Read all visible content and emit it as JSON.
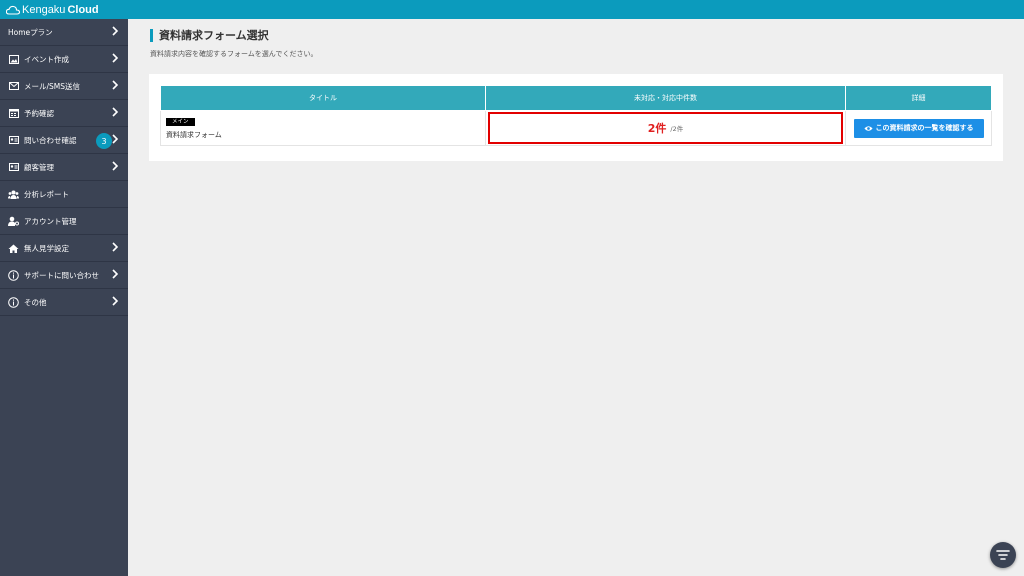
{
  "app": {
    "logo_light": "Kengaku",
    "logo_bold": "Cloud"
  },
  "sidebar": {
    "items": [
      {
        "label": "Homeプラン",
        "icon": "none",
        "has_chevron": true
      },
      {
        "label": "イベント作成",
        "icon": "image-icon",
        "has_chevron": true
      },
      {
        "label": "メール/SMS送信",
        "icon": "mail-icon",
        "has_chevron": true
      },
      {
        "label": "予約確認",
        "icon": "calendar-icon",
        "has_chevron": true
      },
      {
        "label": "問い合わせ確認",
        "icon": "id-card-icon",
        "has_chevron": true,
        "badge": "3"
      },
      {
        "label": "顧客管理",
        "icon": "id-card-icon",
        "has_chevron": true
      },
      {
        "label": "分析レポート",
        "icon": "users-icon",
        "has_chevron": false
      },
      {
        "label": "アカウント管理",
        "icon": "user-gear-icon",
        "has_chevron": false
      },
      {
        "label": "無人見学設定",
        "icon": "home-icon",
        "has_chevron": true
      },
      {
        "label": "サポートに問い合わせ",
        "icon": "info-icon",
        "has_chevron": true
      },
      {
        "label": "その他",
        "icon": "info-icon",
        "has_chevron": true
      }
    ]
  },
  "page": {
    "title": "資料請求フォーム選択",
    "subtitle": "資料請求内容を確認するフォームを選んでください。"
  },
  "table": {
    "headers": {
      "title": "タイトル",
      "count": "未対応・対応中件数",
      "detail": "詳細"
    },
    "rows": [
      {
        "tag": "メイン",
        "name": "資料請求フォーム",
        "count": "2件",
        "total": "/2件",
        "button": "この資料請求の一覧を確認する"
      }
    ]
  },
  "colors": {
    "accent": "#0b9bbd",
    "sidebar_bg": "#3b4354",
    "table_header": "#33a9ba",
    "highlight_border": "#e20000",
    "button_blue": "#1d8fe6"
  }
}
